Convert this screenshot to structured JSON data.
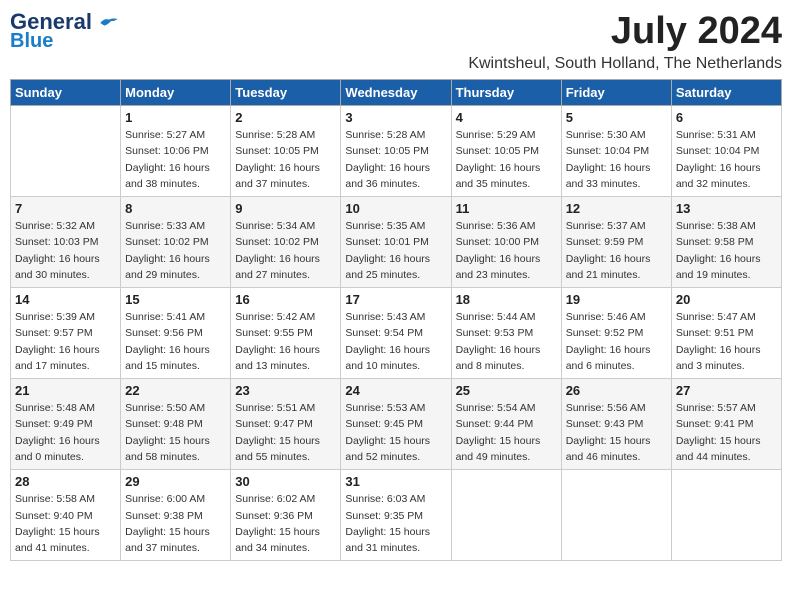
{
  "logo": {
    "line1": "General",
    "line2": "Blue"
  },
  "title": "July 2024",
  "location": "Kwintsheul, South Holland, The Netherlands",
  "header_days": [
    "Sunday",
    "Monday",
    "Tuesday",
    "Wednesday",
    "Thursday",
    "Friday",
    "Saturday"
  ],
  "weeks": [
    [
      {
        "day": "",
        "detail": ""
      },
      {
        "day": "1",
        "detail": "Sunrise: 5:27 AM\nSunset: 10:06 PM\nDaylight: 16 hours\nand 38 minutes."
      },
      {
        "day": "2",
        "detail": "Sunrise: 5:28 AM\nSunset: 10:05 PM\nDaylight: 16 hours\nand 37 minutes."
      },
      {
        "day": "3",
        "detail": "Sunrise: 5:28 AM\nSunset: 10:05 PM\nDaylight: 16 hours\nand 36 minutes."
      },
      {
        "day": "4",
        "detail": "Sunrise: 5:29 AM\nSunset: 10:05 PM\nDaylight: 16 hours\nand 35 minutes."
      },
      {
        "day": "5",
        "detail": "Sunrise: 5:30 AM\nSunset: 10:04 PM\nDaylight: 16 hours\nand 33 minutes."
      },
      {
        "day": "6",
        "detail": "Sunrise: 5:31 AM\nSunset: 10:04 PM\nDaylight: 16 hours\nand 32 minutes."
      }
    ],
    [
      {
        "day": "7",
        "detail": "Sunrise: 5:32 AM\nSunset: 10:03 PM\nDaylight: 16 hours\nand 30 minutes."
      },
      {
        "day": "8",
        "detail": "Sunrise: 5:33 AM\nSunset: 10:02 PM\nDaylight: 16 hours\nand 29 minutes."
      },
      {
        "day": "9",
        "detail": "Sunrise: 5:34 AM\nSunset: 10:02 PM\nDaylight: 16 hours\nand 27 minutes."
      },
      {
        "day": "10",
        "detail": "Sunrise: 5:35 AM\nSunset: 10:01 PM\nDaylight: 16 hours\nand 25 minutes."
      },
      {
        "day": "11",
        "detail": "Sunrise: 5:36 AM\nSunset: 10:00 PM\nDaylight: 16 hours\nand 23 minutes."
      },
      {
        "day": "12",
        "detail": "Sunrise: 5:37 AM\nSunset: 9:59 PM\nDaylight: 16 hours\nand 21 minutes."
      },
      {
        "day": "13",
        "detail": "Sunrise: 5:38 AM\nSunset: 9:58 PM\nDaylight: 16 hours\nand 19 minutes."
      }
    ],
    [
      {
        "day": "14",
        "detail": "Sunrise: 5:39 AM\nSunset: 9:57 PM\nDaylight: 16 hours\nand 17 minutes."
      },
      {
        "day": "15",
        "detail": "Sunrise: 5:41 AM\nSunset: 9:56 PM\nDaylight: 16 hours\nand 15 minutes."
      },
      {
        "day": "16",
        "detail": "Sunrise: 5:42 AM\nSunset: 9:55 PM\nDaylight: 16 hours\nand 13 minutes."
      },
      {
        "day": "17",
        "detail": "Sunrise: 5:43 AM\nSunset: 9:54 PM\nDaylight: 16 hours\nand 10 minutes."
      },
      {
        "day": "18",
        "detail": "Sunrise: 5:44 AM\nSunset: 9:53 PM\nDaylight: 16 hours\nand 8 minutes."
      },
      {
        "day": "19",
        "detail": "Sunrise: 5:46 AM\nSunset: 9:52 PM\nDaylight: 16 hours\nand 6 minutes."
      },
      {
        "day": "20",
        "detail": "Sunrise: 5:47 AM\nSunset: 9:51 PM\nDaylight: 16 hours\nand 3 minutes."
      }
    ],
    [
      {
        "day": "21",
        "detail": "Sunrise: 5:48 AM\nSunset: 9:49 PM\nDaylight: 16 hours\nand 0 minutes."
      },
      {
        "day": "22",
        "detail": "Sunrise: 5:50 AM\nSunset: 9:48 PM\nDaylight: 15 hours\nand 58 minutes."
      },
      {
        "day": "23",
        "detail": "Sunrise: 5:51 AM\nSunset: 9:47 PM\nDaylight: 15 hours\nand 55 minutes."
      },
      {
        "day": "24",
        "detail": "Sunrise: 5:53 AM\nSunset: 9:45 PM\nDaylight: 15 hours\nand 52 minutes."
      },
      {
        "day": "25",
        "detail": "Sunrise: 5:54 AM\nSunset: 9:44 PM\nDaylight: 15 hours\nand 49 minutes."
      },
      {
        "day": "26",
        "detail": "Sunrise: 5:56 AM\nSunset: 9:43 PM\nDaylight: 15 hours\nand 46 minutes."
      },
      {
        "day": "27",
        "detail": "Sunrise: 5:57 AM\nSunset: 9:41 PM\nDaylight: 15 hours\nand 44 minutes."
      }
    ],
    [
      {
        "day": "28",
        "detail": "Sunrise: 5:58 AM\nSunset: 9:40 PM\nDaylight: 15 hours\nand 41 minutes."
      },
      {
        "day": "29",
        "detail": "Sunrise: 6:00 AM\nSunset: 9:38 PM\nDaylight: 15 hours\nand 37 minutes."
      },
      {
        "day": "30",
        "detail": "Sunrise: 6:02 AM\nSunset: 9:36 PM\nDaylight: 15 hours\nand 34 minutes."
      },
      {
        "day": "31",
        "detail": "Sunrise: 6:03 AM\nSunset: 9:35 PM\nDaylight: 15 hours\nand 31 minutes."
      },
      {
        "day": "",
        "detail": ""
      },
      {
        "day": "",
        "detail": ""
      },
      {
        "day": "",
        "detail": ""
      }
    ]
  ]
}
